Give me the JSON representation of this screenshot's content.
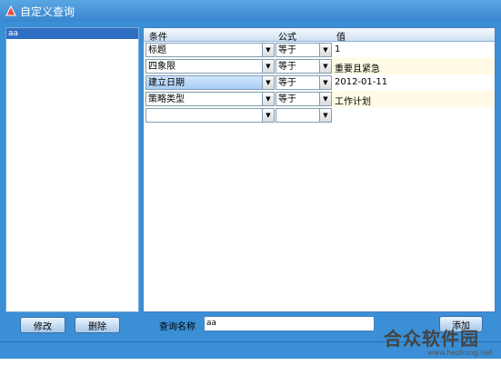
{
  "window": {
    "title": "自定义查询"
  },
  "left_panel": {
    "items": [
      "aa"
    ],
    "edit_label": "修改",
    "delete_label": "删除"
  },
  "grid": {
    "headers": {
      "condition": "条件",
      "formula": "公式",
      "value": "值"
    },
    "rows": [
      {
        "condition": "标题",
        "formula": "等于",
        "value": "1"
      },
      {
        "condition": "四象限",
        "formula": "等于",
        "value": "重要且紧急"
      },
      {
        "condition": "建立日期",
        "formula": "等于",
        "value": "2012-01-11"
      },
      {
        "condition": "策略类型",
        "formula": "等于",
        "value": "工作计划"
      },
      {
        "condition": "",
        "formula": "",
        "value": ""
      }
    ]
  },
  "query": {
    "label": "查询名称",
    "value": "aa",
    "add_label": "添加"
  },
  "watermark": {
    "main": "合众软件园",
    "sub": "www.hezhong.net"
  },
  "colors": {
    "frame": "#3a8fd6",
    "selection": "#2f6fc3"
  }
}
